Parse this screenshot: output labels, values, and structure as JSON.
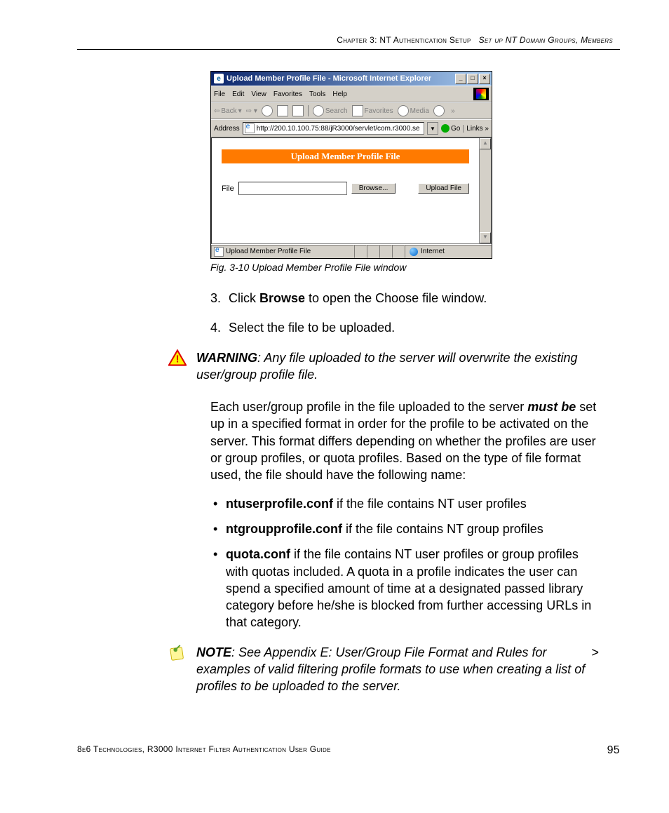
{
  "header": {
    "chapter": "Chapter 3: NT Authentication Setup",
    "section": "Set up NT Domain Groups, Members"
  },
  "screenshot": {
    "title": "Upload Member Profile File - Microsoft Internet Explorer",
    "menus": {
      "file": "File",
      "edit": "Edit",
      "view": "View",
      "favorites": "Favorites",
      "tools": "Tools",
      "help": "Help"
    },
    "toolbar": {
      "back": "Back",
      "search": "Search",
      "favorites": "Favorites",
      "media": "Media"
    },
    "address_label": "Address",
    "address_value": "http://200.10.100.75:88/jR3000/servlet/com.r3000.se",
    "go": "Go",
    "links": "Links",
    "band": "Upload Member Profile File",
    "file_label": "File",
    "browse_btn": "Browse...",
    "upload_btn": "Upload File",
    "status_left": "Upload Member Profile File",
    "status_right": "Internet"
  },
  "caption": "Fig. 3-10  Upload Member Profile File window",
  "steps": {
    "s3_num": "3.",
    "s3_a": "Click ",
    "s3_b": "Browse",
    "s3_c": " to open the Choose file window.",
    "s4_num": "4.",
    "s4": "Select the file to be uploaded."
  },
  "warning": {
    "lead": "WARNING",
    "text": ": Any file uploaded to the server will overwrite the existing user/group profile file."
  },
  "para1_a": "Each user/group profile in the file uploaded to the server ",
  "para1_b": "must be",
  "para1_c": " set up in a specified format in order for the profile to be activated on the server. This format differs depending on whether the profiles are user or group profiles, or quota profiles. Based on the type of file format used, the file should have the following name:",
  "files": {
    "f1_name": "ntuserprofile.conf",
    "f1_rest": " if the file contains NT user profiles",
    "f2_name": "ntgroupprofile.conf",
    "f2_rest": " if the file contains NT group profiles",
    "f3_name": "quota.conf",
    "f3_rest": " if the file contains NT user profiles or group profiles with quotas included. A quota in a profile indicates the user can spend a specified amount of time at a designated passed library category before he/she is blocked from further accessing URLs in that category."
  },
  "note": {
    "lead": "NOTE",
    "text": ": See Appendix E: User/Group File Format and Rules for examples of valid filtering profile formats to use when creating a list of profiles to be uploaded to the server."
  },
  "footer": {
    "text": "8e6 Technologies, R3000 Internet Filter Authentication User Guide",
    "page": "95"
  }
}
